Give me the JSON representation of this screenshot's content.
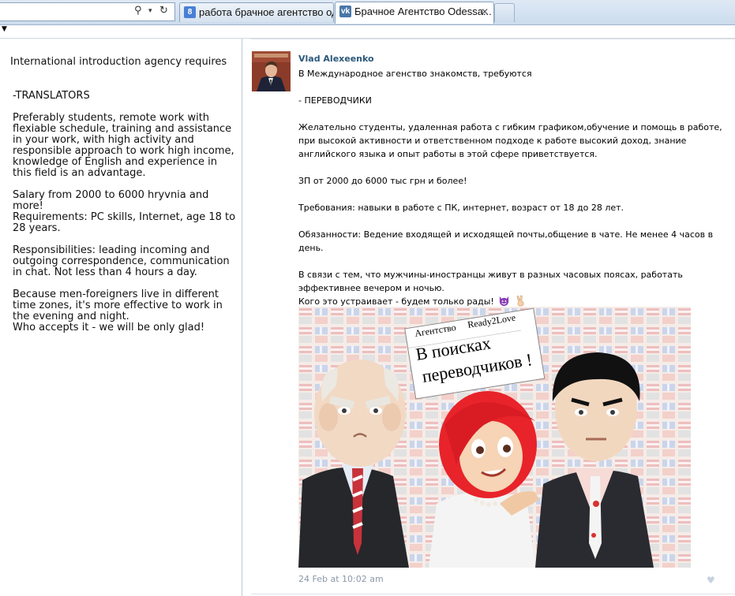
{
  "browser": {
    "tabs": [
      {
        "title": "работа брачное агентство од...",
        "favicon": "google-favicon",
        "active": false
      },
      {
        "title": "Брачное Агентство Odessa...",
        "favicon": "vk-favicon",
        "active": true,
        "close": "✕"
      }
    ]
  },
  "left_pane": {
    "intro": "International introduction agency requires",
    "paragraphs": [
      "-TRANSLATORS",
      "Preferably students, remote work with flexiable schedule, training and assistance in your work, with high activity and responsible approach to work high income, knowledge of English and experience in this field is an advantage.",
      "Salary from 2000 to 6000 hryvnia and more!",
      "Requirements: PC skills, Internet, age 18 to 28 years.",
      "Responsibilities: leading incoming and outgoing correspondence, communication in chat. Not less than 4 hours a day.",
      "Because men-foreigners live in different time zones, it's more effective to work in the evening and night.\nWho accepts it - we will be only glad!"
    ]
  },
  "post": {
    "author": "Vlad Alexeenko",
    "lines": [
      "В Международное агенство знакомств, требуются",
      "",
      "- ПЕРЕВОДЧИКИ",
      "",
      "Желательно студенты, удаленная работа с гибким графиком,обучение и помощь в работе, при высокой активности и ответственном подходе к работе высокий доход, знание английского языка и опыт работы в этой сфере приветствуется.",
      "",
      "ЗП от 2000 до 6000 тыс грн и более!",
      "",
      "Требования: навыки в работе с ПК, интернет, возраст от 18 до 28 лет.",
      "",
      "Обязанности: Ведение входящей и исходящей почты,общение в чате. Не менее 4 часов в день.",
      "",
      "В связи с тем, что мужчины-иностранцы живут в разных часовых поясах, работать эффективнее вечером и ночью.",
      "Кого это устраивает - будем только рады!"
    ],
    "emoji": [
      "devil-emoji",
      "victory-hand-emoji"
    ],
    "image": {
      "sign_agency": "Агентство",
      "sign_brand": "Ready2Love",
      "sign_headline_1": "В поисках",
      "sign_headline_2": "переводчиков !"
    },
    "date": "24 Feb at 10:02 am",
    "like_icon": "heart-icon",
    "colors": {
      "author": "#2b587a",
      "date": "#8a98a8",
      "vk_brand": "#4a76a8",
      "hair": "#e8232a"
    }
  }
}
